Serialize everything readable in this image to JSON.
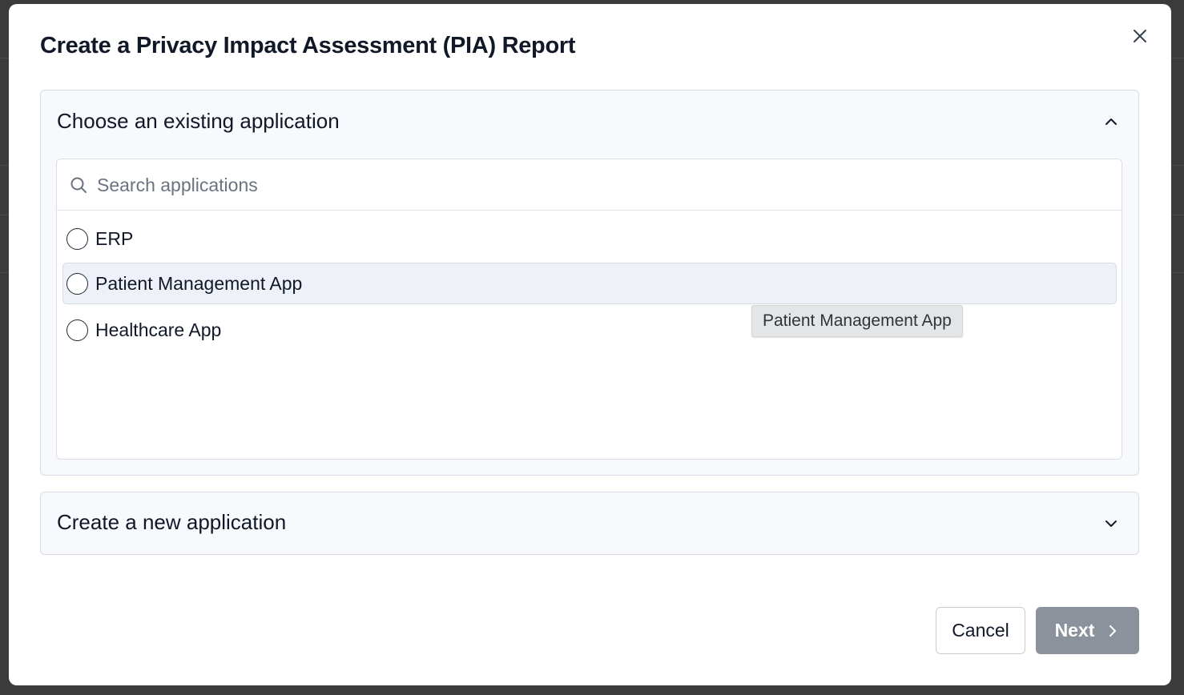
{
  "modal": {
    "title": "Create a Privacy Impact Assessment (PIA) Report",
    "close_icon": "close-icon"
  },
  "existing_section": {
    "title": "Choose an existing application",
    "expanded": true,
    "toggle_icon": "chevron-up-icon",
    "search": {
      "placeholder": "Search applications",
      "value": "",
      "icon": "search-icon"
    },
    "options": [
      {
        "label": "ERP",
        "selected": false
      },
      {
        "label": "Patient Management App",
        "selected": false,
        "hovered": true
      },
      {
        "label": "Healthcare App",
        "selected": false
      }
    ],
    "tooltip": "Patient Management App"
  },
  "new_section": {
    "title": "Create a new application",
    "expanded": false,
    "toggle_icon": "chevron-down-icon"
  },
  "footer": {
    "cancel_label": "Cancel",
    "next_label": "Next",
    "next_icon": "chevron-right-icon"
  },
  "colors": {
    "next_button_disabled": "#8c929b",
    "panel_background": "#f7f9fc",
    "hover_row": "#eef2f8"
  }
}
